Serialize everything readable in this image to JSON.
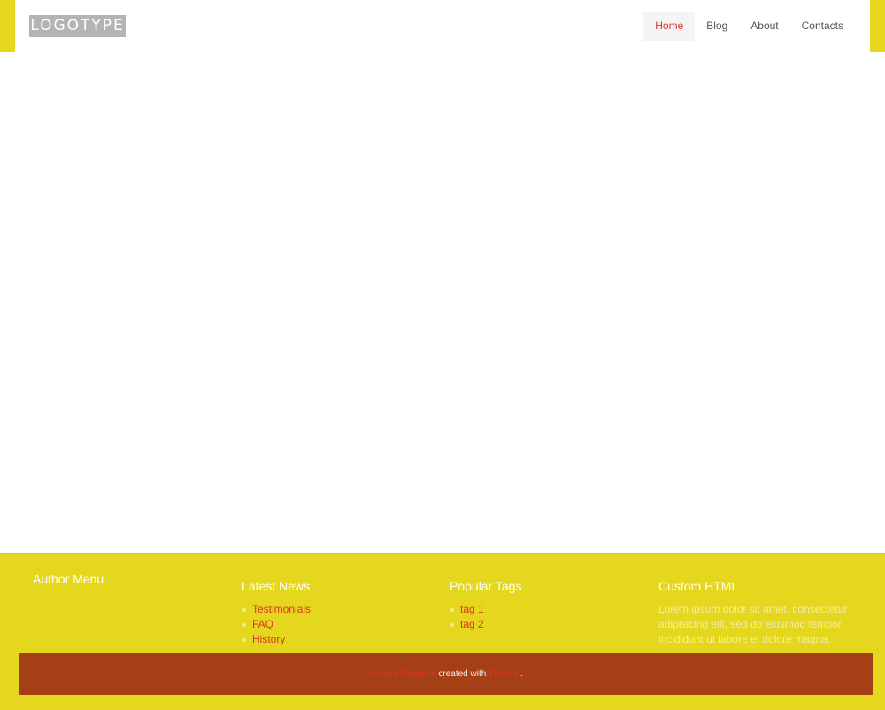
{
  "header": {
    "logo_text": "LOGOTYPE",
    "nav": [
      {
        "label": "Home",
        "active": true
      },
      {
        "label": "Blog",
        "active": false
      },
      {
        "label": "About",
        "active": false
      },
      {
        "label": "Contacts",
        "active": false
      }
    ]
  },
  "footer": {
    "author_menu": {
      "title": "Author Menu"
    },
    "latest_news": {
      "title": "Latest News",
      "items": [
        "Testimonials",
        "FAQ",
        "History"
      ]
    },
    "popular_tags": {
      "title": "Popular Tags",
      "items": [
        "tag 1",
        "tag 2"
      ]
    },
    "custom_html": {
      "title": "Custom HTML",
      "text": "Lorem ipsum dolor sit amet, consectetur adipisicing elit, sed do eiusmod tempor incididunt ut labore et dolore magna."
    }
  },
  "copyright": {
    "link1": "Joomla Template",
    "middle": " created with ",
    "link2": "Themler",
    "end": "."
  },
  "colors": {
    "accent_yellow": "#e5d61e",
    "link_red": "#e2312a",
    "footer_bar": "#a43f16",
    "logo_gray": "#b4b4b4"
  }
}
